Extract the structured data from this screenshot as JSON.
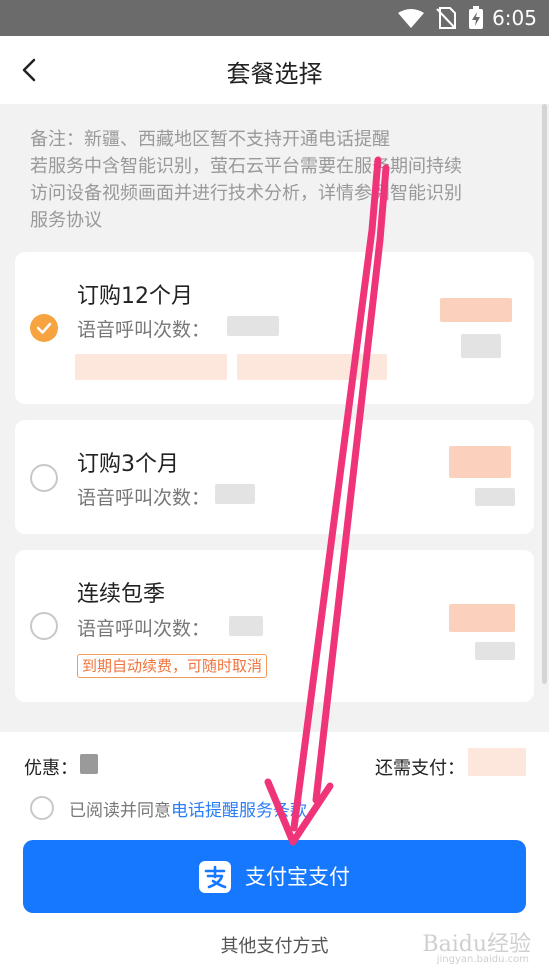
{
  "status_bar": {
    "time": "6:05",
    "icons": [
      "wifi-icon",
      "no-sim-icon",
      "battery-charging-icon"
    ]
  },
  "header": {
    "title": "套餐选择",
    "back_icon": "chevron-left-icon"
  },
  "notes": {
    "lines": [
      "备注：新疆、西藏地区暂不支持开通电话提醒",
      "若服务中含智能识别，萤石云平台需要在服务期间持续",
      "访问设备视频画面并进行技术分析，详情参阅智能识别",
      "服务协议"
    ]
  },
  "plans": [
    {
      "name": "订购12个月",
      "calls_label": "语音呼叫次数：",
      "selected": true
    },
    {
      "name": "订购3个月",
      "calls_label": "语音呼叫次数：",
      "selected": false
    },
    {
      "name": "连续包季",
      "calls_label": "语音呼叫次数：",
      "selected": false,
      "tag": "到期自动续费，可随时取消"
    }
  ],
  "footer": {
    "discount_label": "优惠：",
    "pay_label": "还需支付：",
    "agree_text": "已阅读并同意",
    "agree_link": "电话提醒服务条款",
    "alipay_button": "支付宝支付",
    "other_payment": "其他支付方式"
  },
  "watermark": {
    "text": "Baidu经验",
    "sub": "jingyan.baidu.com"
  },
  "colors": {
    "primary": "#1677ff",
    "selected_radio": "#f7a33f",
    "tag_text": "#f0743c",
    "link": "#2a7ef7",
    "annotation_arrow": "#f0347a"
  }
}
